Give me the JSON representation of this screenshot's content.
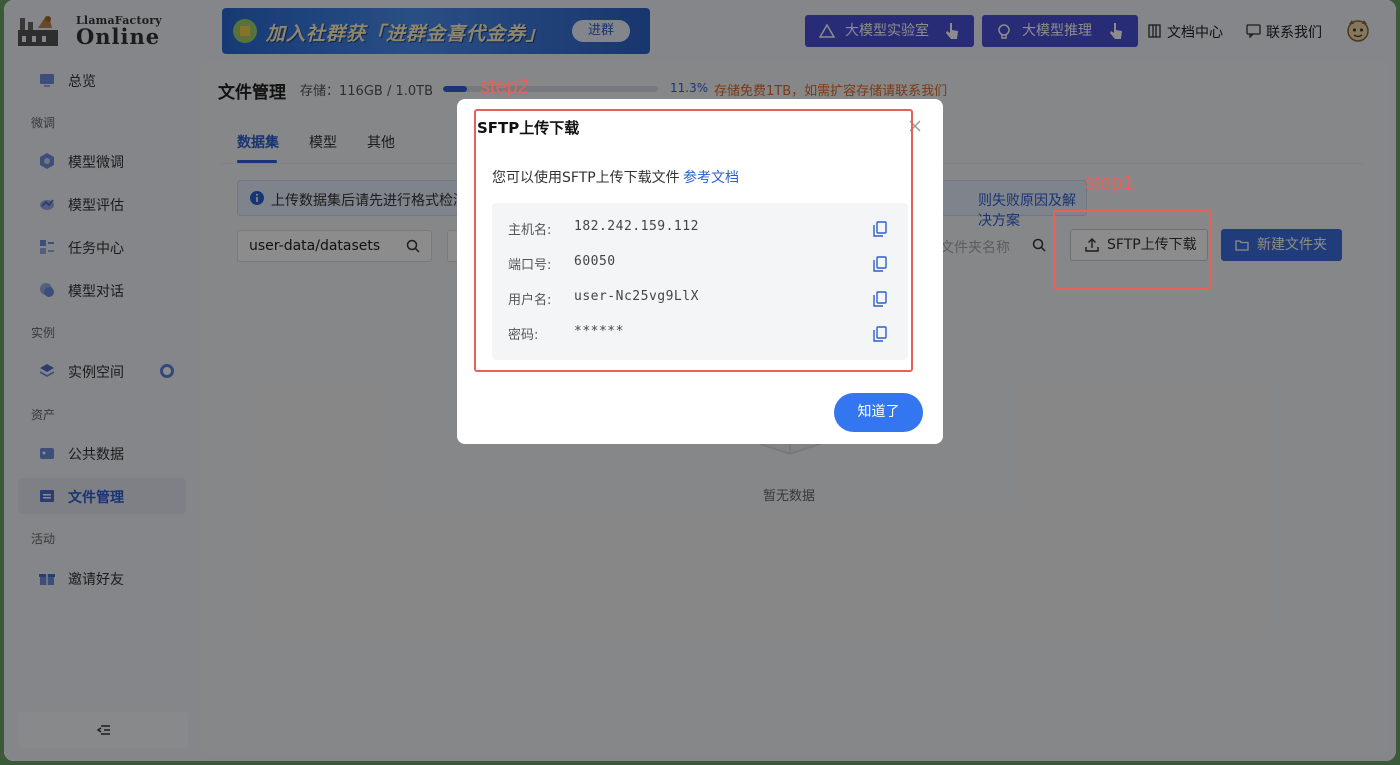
{
  "header": {
    "logo_top": "LlamaFactory",
    "logo_bottom": "Online",
    "banner_text": "加入社群获「进群金喜代金券」",
    "banner_button": "进群",
    "lab_button": "大模型实验室",
    "inference_button": "大模型推理",
    "docs_link": "文档中心",
    "contact_link": "联系我们"
  },
  "sidebar": {
    "overview": "总览",
    "group_finetune": "微调",
    "finetune": "模型微调",
    "evaluate": "模型评估",
    "tasks": "任务中心",
    "chat": "模型对话",
    "group_instance": "实例",
    "instance_space": "实例空间",
    "group_assets": "资产",
    "public_data": "公共数据",
    "file_manage": "文件管理",
    "group_activity": "活动",
    "invite": "邀请好友"
  },
  "main": {
    "title": "文件管理",
    "storage_label": "存储：116GB / 1.0TB",
    "storage_fraction": 0.113,
    "storage_percent": "11.3%",
    "storage_note": "存储免费1TB，如需扩容存储请联系我们",
    "tabs": [
      "数据集",
      "模型",
      "其他"
    ],
    "notice_text": "上传数据集后请先进行格式检测",
    "notice_link": "则失败原因及解决方案",
    "path_value": "user-data/datasets",
    "search_placeholder": "文件夹名称",
    "sftp_button": "SFTP上传下载",
    "new_folder_button": "新建文件夹",
    "empty_text": "暂无数据"
  },
  "modal": {
    "title": "SFTP上传下载",
    "desc": "您可以使用SFTP上传下载文件",
    "desc_link": "参考文档",
    "rows": [
      {
        "key": "主机名:",
        "value": "182.242.159.112"
      },
      {
        "key": "端口号:",
        "value": "60050"
      },
      {
        "key": "用户名:",
        "value": "user-Nc25vg9LlX"
      },
      {
        "key": "密码:",
        "value": "******"
      }
    ],
    "ok_button": "知道了"
  },
  "annotations": {
    "step1": "step1",
    "step2": "step2"
  },
  "colors": {
    "primary": "#3476f0",
    "annotation": "#e8605a",
    "warning": "#e06a2a"
  }
}
